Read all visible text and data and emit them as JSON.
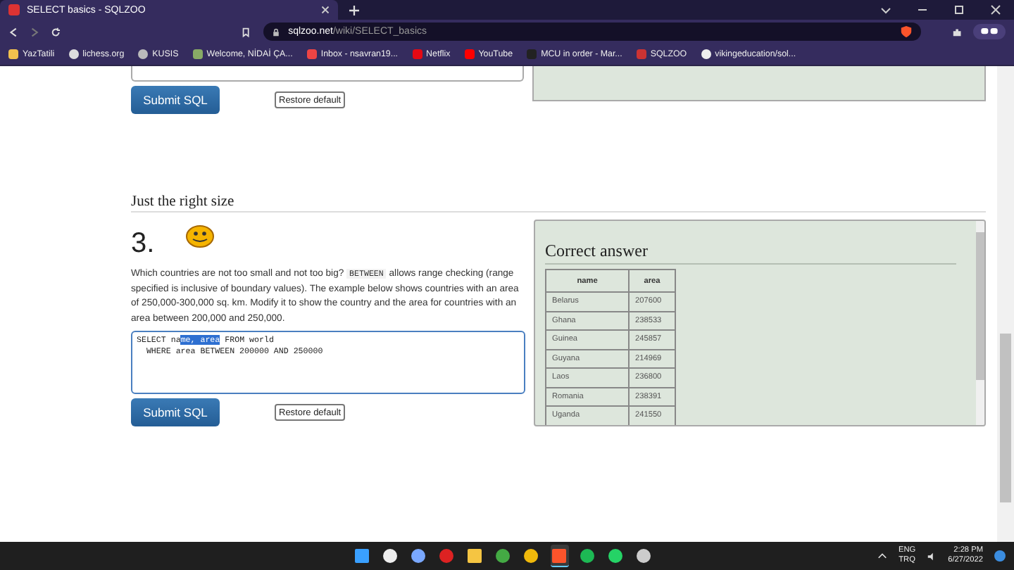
{
  "browser": {
    "tab_title": "SELECT basics - SQLZOO",
    "url_domain": "sqlzoo.net",
    "url_path": "/wiki/SELECT_basics",
    "bookmarks": [
      {
        "label": "YazTatili",
        "kind": "folder"
      },
      {
        "label": "lichess.org",
        "kind": "knight"
      },
      {
        "label": "KUSIS",
        "kind": "globe"
      },
      {
        "label": "Welcome, NİDAİ ÇA...",
        "kind": "square"
      },
      {
        "label": "Inbox - nsavran19...",
        "kind": "mail"
      },
      {
        "label": "Netflix",
        "kind": "netflix"
      },
      {
        "label": "YouTube",
        "kind": "video"
      },
      {
        "label": "MCU in order - Mar...",
        "kind": "ds"
      },
      {
        "label": "SQLZOO",
        "kind": "sqlzoo"
      },
      {
        "label": "vikingeducation/sol...",
        "kind": "github"
      }
    ]
  },
  "previous_exercise": {
    "submit": "Submit SQL",
    "restore": "Restore default"
  },
  "section": {
    "heading": "Just the right size",
    "number": "3.",
    "paragraph": [
      {
        "kind": "text",
        "text": "Which countries are not too small and not too big? "
      },
      {
        "kind": "code",
        "text": "BETWEEN"
      },
      {
        "kind": "text",
        "text": " allows range checking (range specified is inclusive of boundary values). The example below shows countries with an area of 250,000-300,000 sq. km. Modify it to show the country and the area for countries with an area between 200,000 and 250,000."
      }
    ],
    "editor": [
      {
        "before": "SELECT na",
        "selected": "me, area",
        "after": " FROM world"
      },
      {
        "before": "  WHERE area BETWEEN 200000 AND 250000"
      }
    ],
    "submit": "Submit SQL",
    "restore": "Restore default",
    "answer": {
      "heading": "Correct answer",
      "columns": [
        "name",
        "area"
      ],
      "rows": [
        [
          "Belarus",
          "207600"
        ],
        [
          "Ghana",
          "238533"
        ],
        [
          "Guinea",
          "245857"
        ],
        [
          "Guyana",
          "214969"
        ],
        [
          "Laos",
          "236800"
        ],
        [
          "Romania",
          "238391"
        ],
        [
          "Uganda",
          "241550"
        ]
      ]
    }
  },
  "taskbar": {
    "apps": [
      {
        "kind": "windows",
        "active": false
      },
      {
        "kind": "search",
        "active": false
      },
      {
        "kind": "chat",
        "active": false
      },
      {
        "kind": "red",
        "active": false
      },
      {
        "kind": "folder",
        "active": false
      },
      {
        "kind": "chrome",
        "active": false
      },
      {
        "kind": "binance",
        "active": false
      },
      {
        "kind": "brave",
        "active": true
      },
      {
        "kind": "spotify",
        "active": false
      },
      {
        "kind": "whatsapp",
        "active": false
      },
      {
        "kind": "steam",
        "active": false
      }
    ],
    "language": "ENG",
    "layout": "TRQ",
    "time": "2:28 PM",
    "date": "6/27/2022"
  }
}
